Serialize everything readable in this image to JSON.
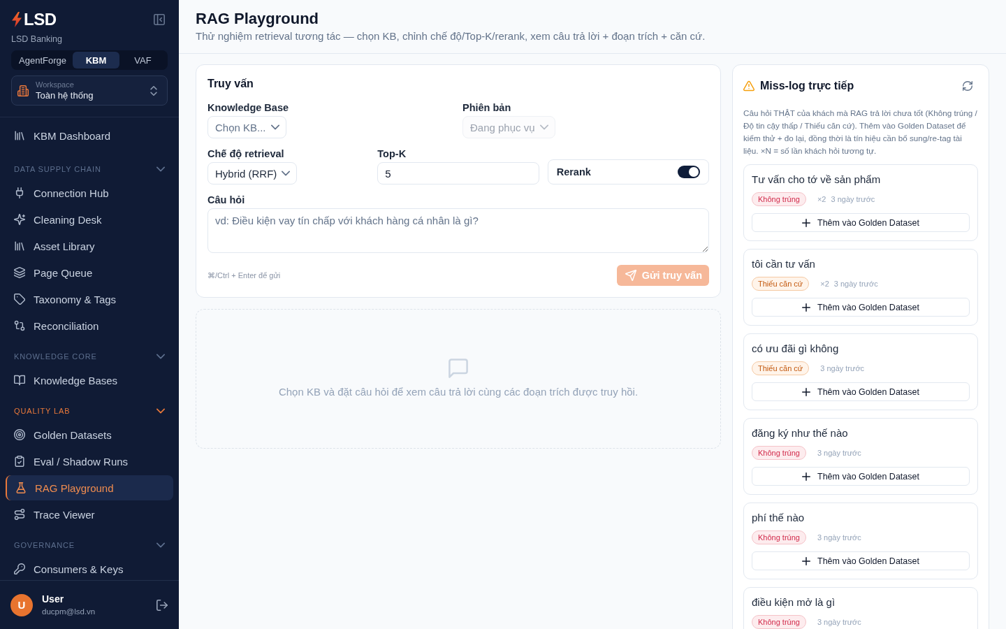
{
  "sidebar": {
    "logo": "LSD",
    "org": "LSD Banking",
    "app_tabs": [
      {
        "label": "AgentForge",
        "selected": false
      },
      {
        "label": "KBM",
        "selected": true
      },
      {
        "label": "VAF",
        "selected": false
      }
    ],
    "workspace": {
      "label": "Workspace",
      "value": "Toàn hệ thống"
    },
    "groups": [
      {
        "items": [
          {
            "label": "KBM Dashboard",
            "selected": false
          }
        ]
      },
      {
        "title": "DATA SUPPLY CHAIN",
        "expanded": true,
        "items": [
          {
            "label": "Connection Hub",
            "selected": false
          },
          {
            "label": "Cleaning Desk",
            "selected": false
          },
          {
            "label": "Asset Library",
            "selected": false
          },
          {
            "label": "Page Queue",
            "selected": false
          },
          {
            "label": "Taxonomy & Tags",
            "selected": false
          },
          {
            "label": "Reconciliation",
            "selected": false
          }
        ]
      },
      {
        "title": "KNOWLEDGE CORE",
        "expanded": true,
        "items": [
          {
            "label": "Knowledge Bases",
            "selected": false
          }
        ]
      },
      {
        "title": "QUALITY LAB",
        "expanded": true,
        "items": [
          {
            "label": "Golden Datasets",
            "selected": false
          },
          {
            "label": "Eval / Shadow Runs",
            "selected": false
          },
          {
            "label": "RAG Playground",
            "selected": true
          },
          {
            "label": "Trace Viewer",
            "selected": false
          }
        ]
      },
      {
        "title": "GOVERNANCE",
        "expanded": true,
        "items": [
          {
            "label": "Consumers & Keys",
            "selected": false
          }
        ]
      }
    ],
    "user": {
      "initial": "U",
      "name": "User",
      "email": "ducpm@lsd.vn"
    }
  },
  "header": {
    "title": "RAG Playground",
    "subtitle": "Thử nghiệm retrieval tương tác — chọn KB, chỉnh chế độ/Top-K/rerank, xem câu trả lời + đoạn trích + căn cứ."
  },
  "query": {
    "title": "Truy vấn",
    "knowledge_base": {
      "label": "Knowledge Base",
      "placeholder": "Chọn KB..."
    },
    "version": {
      "label": "Phiên bản",
      "value": "Đang phục vụ",
      "disabled": true
    },
    "mode": {
      "label": "Chế độ retrieval",
      "value": "Hybrid (RRF)"
    },
    "top_k": {
      "label": "Top-K",
      "value": "5"
    },
    "rerank": {
      "label": "Rerank",
      "on": true
    },
    "question": {
      "label": "Câu hỏi",
      "placeholder": "vd: Điều kiện vay tín chấp với khách hàng cá nhân là gì?"
    },
    "hint": "⌘/Ctrl + Enter để gửi",
    "submit": {
      "label": "Gửi truy vấn",
      "disabled": true
    }
  },
  "answer": {
    "empty_text": "Chọn KB và đặt câu hỏi để xem câu trả lời cùng các đoạn trích được truy hồi."
  },
  "miss_log": {
    "title": "Miss-log trực tiếp",
    "description": "Câu hỏi THẬT của khách mà RAG trả lời chưa tốt (Không trúng / Độ tin cậy thấp / Thiếu căn cứ). Thêm vào Golden Dataset để kiểm thử + đo lại, đồng thời là tín hiệu cần bổ sung/re-tag tài liệu. ×N = số lần khách hỏi tương tự.",
    "items": [
      {
        "question": "Tư vấn cho tớ về sản phẩm",
        "status": {
          "label": "Không trúng",
          "kind": "miss"
        },
        "count": "×2",
        "time": "3 ngày trước",
        "action": "Thêm vào Golden Dataset"
      },
      {
        "question": "tôi cần tư vấn",
        "status": {
          "label": "Thiếu căn cứ",
          "kind": "no_evidence"
        },
        "count": "×2",
        "time": "3 ngày trước",
        "action": "Thêm vào Golden Dataset"
      },
      {
        "question": "có ưu đãi gì không",
        "status": {
          "label": "Thiếu căn cứ",
          "kind": "no_evidence"
        },
        "time": "3 ngày trước",
        "action": "Thêm vào Golden Dataset"
      },
      {
        "question": "đăng ký như thế nào",
        "status": {
          "label": "Không trúng",
          "kind": "miss"
        },
        "time": "3 ngày trước",
        "action": "Thêm vào Golden Dataset"
      },
      {
        "question": "phí thế nào",
        "status": {
          "label": "Không trúng",
          "kind": "miss"
        },
        "time": "3 ngày trước",
        "action": "Thêm vào Golden Dataset"
      },
      {
        "question": "điều kiện mở là gì",
        "status": {
          "label": "Không trúng",
          "kind": "miss"
        },
        "time": "3 ngày trước"
      }
    ]
  }
}
